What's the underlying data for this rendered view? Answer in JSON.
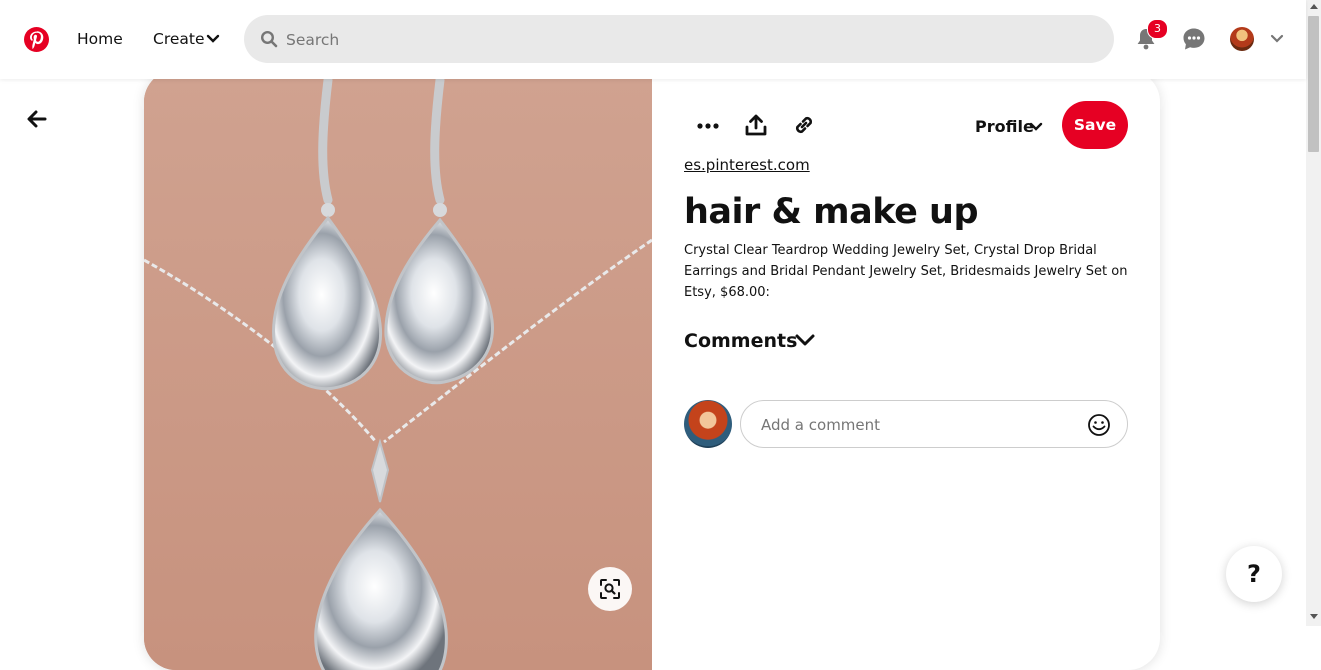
{
  "header": {
    "home_label": "Home",
    "create_label": "Create",
    "search_placeholder": "Search",
    "notifications_count": "3"
  },
  "pin": {
    "profile_label": "Profile",
    "save_label": "Save",
    "source_link": "es.pinterest.com",
    "title": "hair & make up",
    "description": "Crystal Clear Teardrop Wedding Jewelry Set, Crystal Drop Bridal Earrings and Bridal Pendant Jewelry Set, Bridesmaids Jewelry Set on Etsy, $68.00:",
    "comments_label": "Comments",
    "comment_placeholder": "Add a comment"
  },
  "help": {
    "label": "?"
  },
  "colors": {
    "brand": "#e60023",
    "search_bg": "#e9e9e9",
    "icon": "#111111"
  },
  "icons": [
    "pinterest-logo",
    "chevron-down-icon",
    "search-icon",
    "bell-icon",
    "chat-icon",
    "back-arrow-icon",
    "more-icon",
    "share-icon",
    "link-icon",
    "visual-search-icon",
    "emoji-icon"
  ]
}
